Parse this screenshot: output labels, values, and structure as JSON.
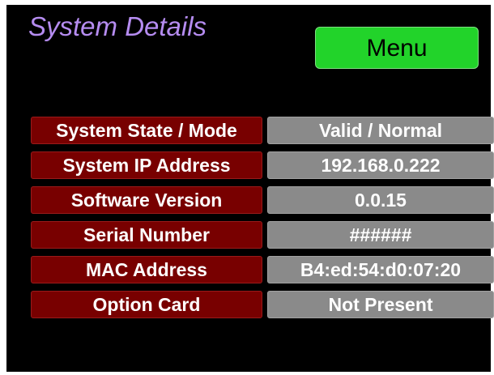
{
  "header": {
    "title": "System Details",
    "menu_label": "Menu"
  },
  "details": [
    {
      "label": "System State / Mode",
      "value": "Valid / Normal"
    },
    {
      "label": "System IP Address",
      "value": "192.168.0.222"
    },
    {
      "label": "Software Version",
      "value": "0.0.15"
    },
    {
      "label": "Serial Number",
      "value": "######"
    },
    {
      "label": "MAC Address",
      "value": "B4:ed:54:d0:07:20"
    },
    {
      "label": "Option Card",
      "value": "Not Present"
    }
  ],
  "colors": {
    "background": "#000000",
    "title": "#b58cf0",
    "menu_button": "#22d32a",
    "label_cell": "#780000",
    "value_cell": "#8a8a8a"
  }
}
